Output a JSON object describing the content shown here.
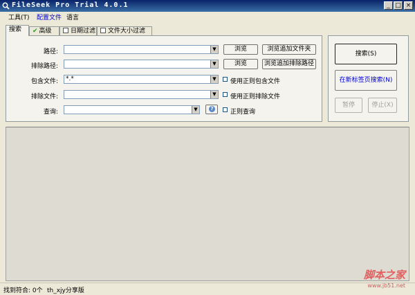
{
  "window": {
    "title": "FileSeek Pro Trial 4.0.1"
  },
  "menu": [
    "工具(T)",
    "配置文件",
    "语言"
  ],
  "tabs": [
    "搜索",
    "高级",
    "日期过滤",
    "文件大小过滤"
  ],
  "form": {
    "path_label": "路径:",
    "exclude_path_label": "排除路径:",
    "include_files_label": "包含文件:",
    "include_files_value": "*.*",
    "exclude_files_label": "排除文件:",
    "query_label": "查询:",
    "browse_label": "浏览",
    "browse_add_folder_label": "浏览追加文件夹",
    "browse_add_exclude_label": "浏览追加排除路径",
    "regex_include_label": "使用正则包含文件",
    "regex_exclude_label": "使用正则排除文件",
    "regex_query_label": "正则查询"
  },
  "actions": {
    "search_label": "搜索(S)",
    "new_tab_search_label": "在新标签页搜索(N)",
    "pause_label": "暂停",
    "stop_label": "停止(X)"
  },
  "status": {
    "matches_label": "找到符合: 0个",
    "share_label": "th_xjy分享版"
  },
  "watermark": {
    "brand": "脚本之家",
    "url": "www.jb51.net"
  },
  "colors": {
    "accent_blue": "#0000cc",
    "title_bar": "#0a246a"
  }
}
